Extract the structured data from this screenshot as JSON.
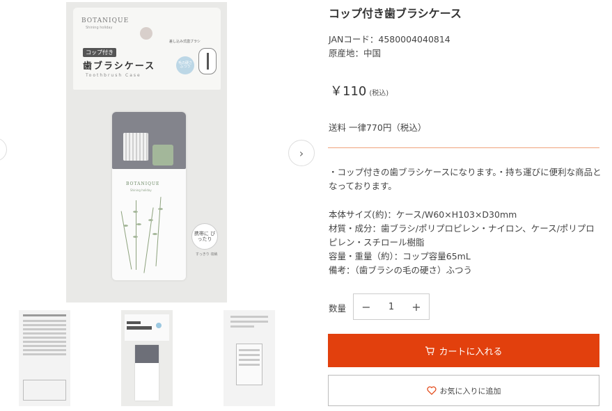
{
  "product": {
    "title": "コップ付き歯ブラシケース",
    "jan": "JANコード：4580004040814",
    "origin": "原産地：中国",
    "price": "￥110",
    "price_tax": "(税込)",
    "shipping": "送料 一律770円（税込）",
    "description": "・コップ付きの歯ブラシケースになります。・持ち運びに便利な商品となっております。",
    "specs": [
      "本体サイズ(約)：ケース/W60×H103×D30mm",
      "材質・成分：歯ブラシ/ポリプロピレン・ナイロン、ケース/ポリプロピレン・スチロール樹脂",
      "容量・重量（約）：コップ容量65mL",
      "備考：（歯ブラシの毛の硬さ）ふつう"
    ]
  },
  "quantity": {
    "label": "数量",
    "value": "1",
    "minus": "−",
    "plus": "+"
  },
  "buttons": {
    "cart": "カートに入れる",
    "favorite": "お気に入りに追加"
  },
  "gallery": {
    "package_brand": "BOTANIQUE",
    "package_subtitle": "Shining holiday",
    "package_tag": "コップ付き",
    "package_name": "歯ブラシケース",
    "package_english": "Toothbrush Case",
    "package_note": "差し込み式歯ブラシ",
    "package_badge": "毛の硬さ ふつう",
    "cup_brand": "BOTANIQUE",
    "cup_subtitle": "Shining holiday",
    "bubble_text": "携帯に ぴったり",
    "bubble_note": "すっきり 収納",
    "thumbnails": [
      "back-view",
      "front-view",
      "back-label"
    ],
    "next_arrow": "›"
  },
  "colors": {
    "accent": "#e2400d",
    "divider": "#f0a27c"
  }
}
